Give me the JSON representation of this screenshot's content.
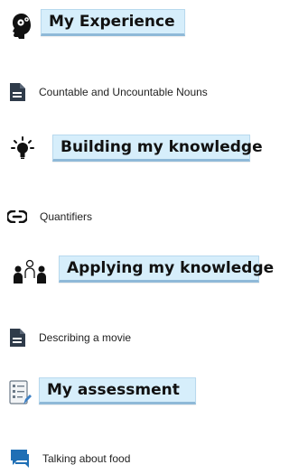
{
  "sections": [
    {
      "title": "My Experience",
      "icon": "brain-head-icon"
    },
    {
      "title": "Building my knowledge",
      "icon": "lightbulb-icon"
    },
    {
      "title": "Applying my knowledge",
      "icon": "people-icon"
    },
    {
      "title": "My assessment",
      "icon": "checklist-icon"
    }
  ],
  "links": [
    {
      "label": "Countable and Uncountable Nouns",
      "icon": "document-icon"
    },
    {
      "label": "Quantifiers",
      "icon": "link-icon"
    },
    {
      "label": "Describing a movie",
      "icon": "document-icon"
    },
    {
      "label": "Talking about food",
      "icon": "forum-icon"
    }
  ],
  "colors": {
    "banner_bg": "#d6eefb",
    "icon_dark": "#2f3b4a",
    "forum_blue": "#1f6fb5"
  }
}
